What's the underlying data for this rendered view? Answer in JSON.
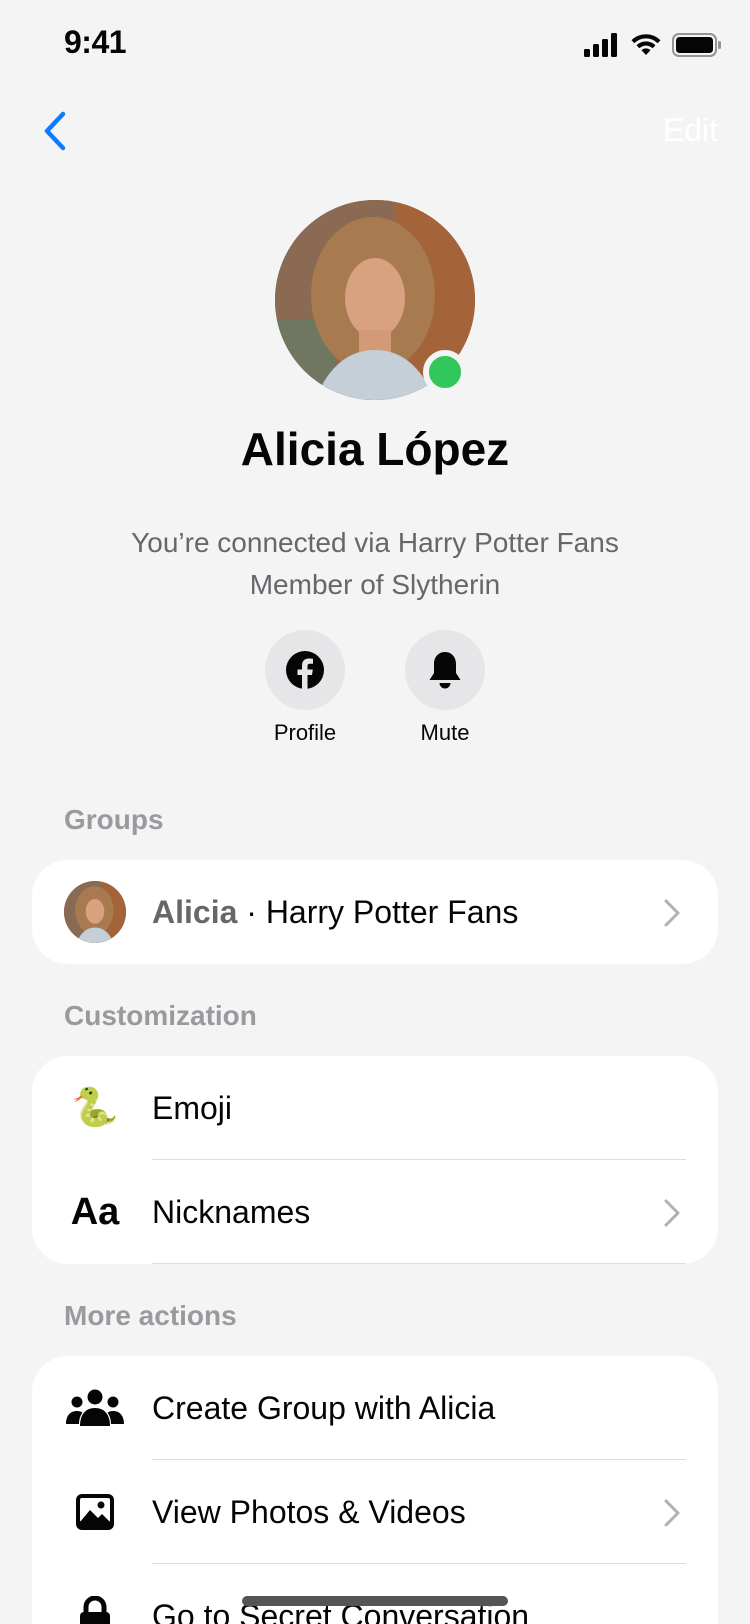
{
  "status": {
    "time": "9:41"
  },
  "nav": {
    "edit_label": "Edit"
  },
  "profile": {
    "name": "Alicia López",
    "connection": "You’re connected via Harry Potter Fans",
    "membership": "Member of Slytherin",
    "online": true
  },
  "quick_actions": [
    {
      "label": "Profile",
      "icon": "facebook-icon"
    },
    {
      "label": "Mute",
      "icon": "bell-icon"
    }
  ],
  "groups": {
    "header": "Groups",
    "items": [
      {
        "name_bold": "Alicia",
        "separator": " · ",
        "group": "Harry Potter Fans"
      }
    ]
  },
  "customization": {
    "header": "Customization",
    "items": [
      {
        "label": "Emoji",
        "icon": "🐍"
      },
      {
        "label": "Nicknames",
        "icon": "Aa"
      }
    ]
  },
  "more_actions": {
    "header": "More actions",
    "items": [
      {
        "label": "Create Group with Alicia",
        "icon": "people-icon"
      },
      {
        "label": "View Photos & Videos",
        "icon": "photo-icon"
      },
      {
        "label": "Go to Secret Conversation",
        "icon": "lock-icon"
      }
    ]
  },
  "colors": {
    "accent": "#0a7cff",
    "online": "#31c75a",
    "background": "#f4f4f5",
    "section_header": "#9a9a9e"
  }
}
